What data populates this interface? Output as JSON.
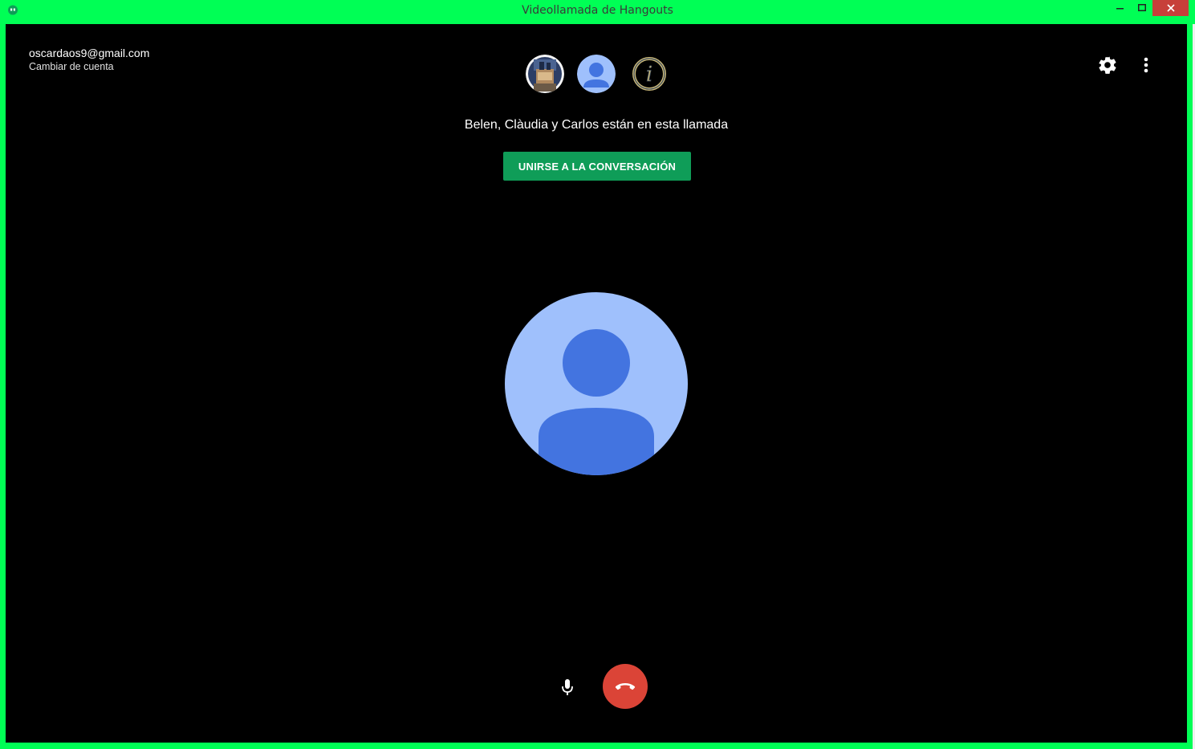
{
  "window": {
    "title": "Videollamada de Hangouts",
    "minimize_icon": "minimize-icon",
    "maximize_icon": "maximize-icon",
    "close_icon": "close-icon",
    "frame_color": "#00ff55"
  },
  "account": {
    "email": "oscardaos9@gmail.com",
    "switch_label": "Cambiar de cuenta"
  },
  "participants": {
    "avatars": [
      "photo-avatar",
      "default-avatar",
      "at-sign-avatar"
    ],
    "caption": "Belen, Clàudia y Carlos están en esta llamada"
  },
  "join_button": {
    "label": "UNIRSE A LA CONVERSACIÓN",
    "color": "#0f9d58"
  },
  "main_avatar": {
    "icon": "person-avatar-icon",
    "bg_color": "#9fc0fc",
    "fg_color": "#4374e0"
  },
  "toolbar": {
    "settings_icon": "gear-icon",
    "more_icon": "more-vertical-icon"
  },
  "controls": {
    "mic_icon": "microphone-icon",
    "hangup_icon": "hang-up-icon",
    "hangup_color": "#db4437"
  }
}
